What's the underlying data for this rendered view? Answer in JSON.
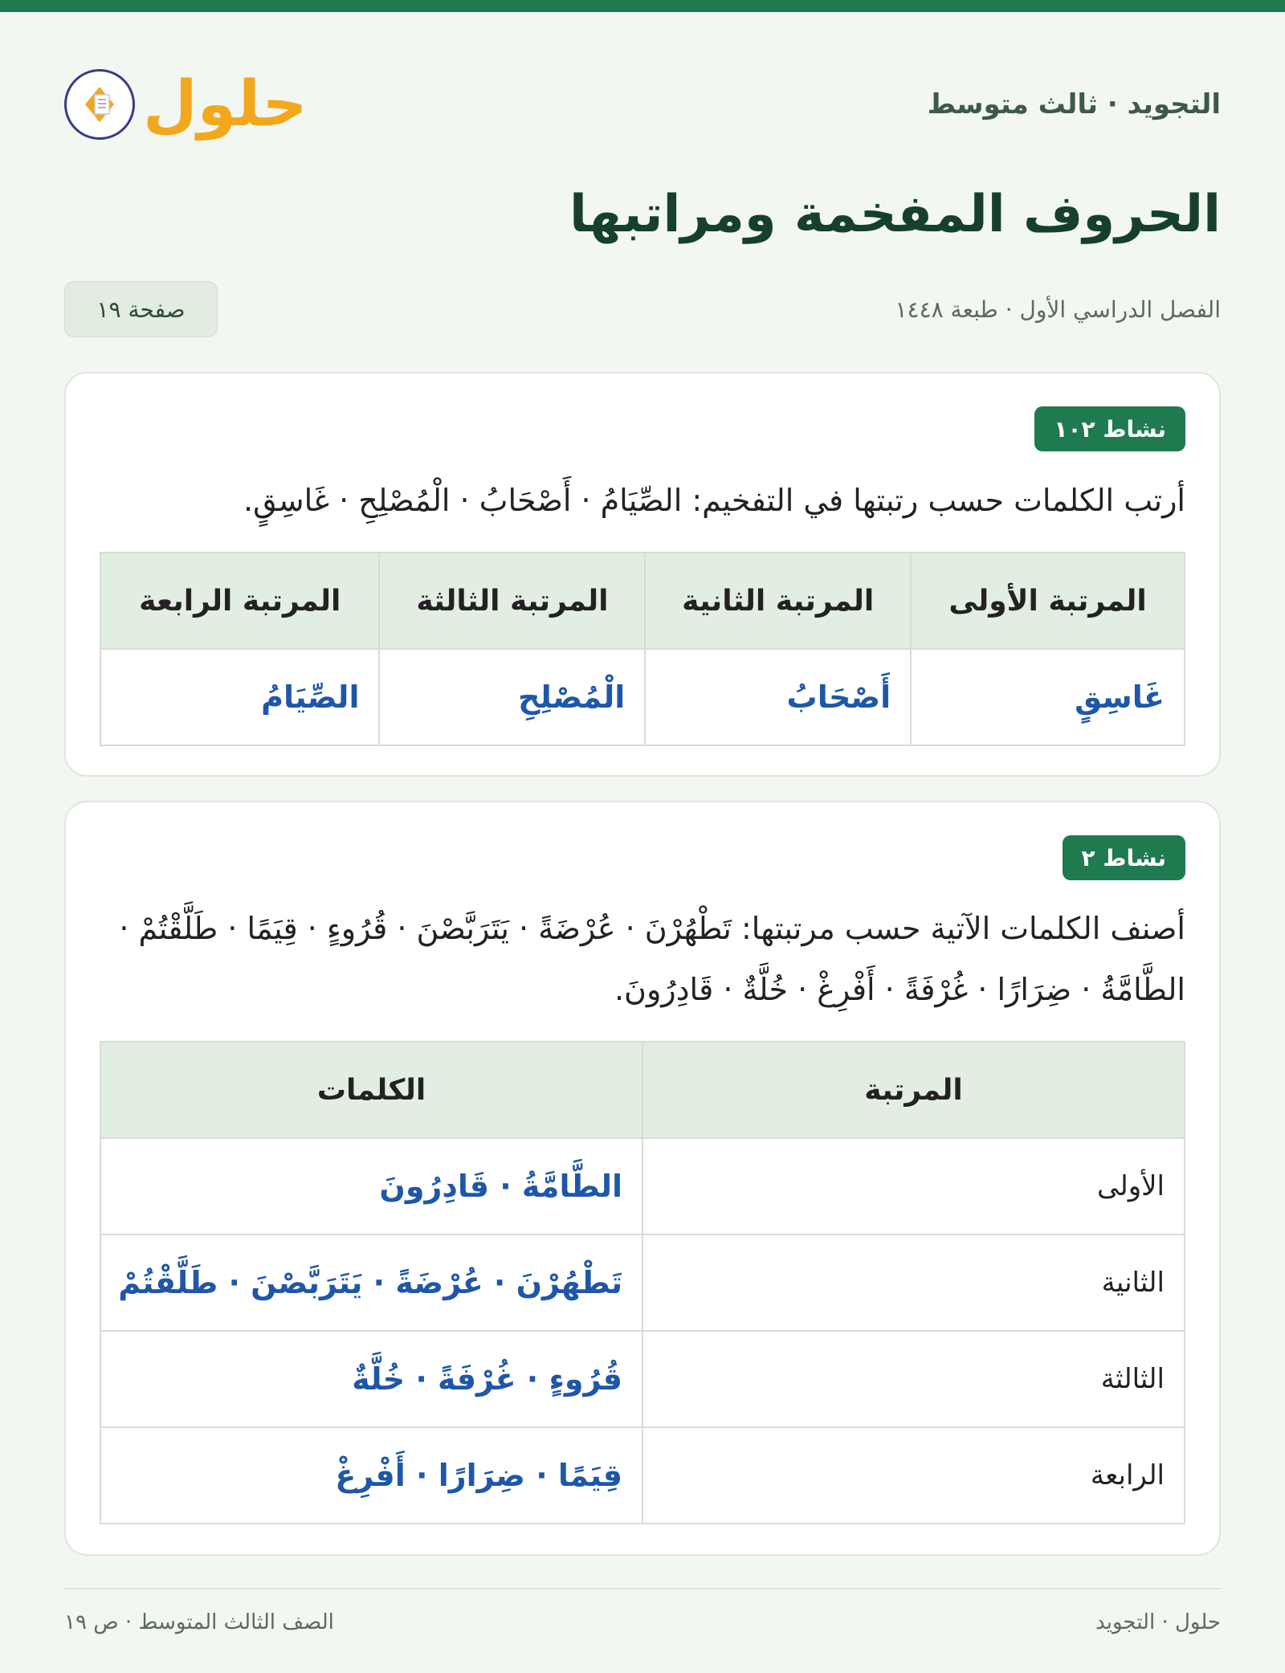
{
  "header": {
    "subject": "التجويد · ثالث متوسط",
    "logo_text": "حلول"
  },
  "title": "الحروف المفخمة ومراتبها",
  "meta": {
    "term": "الفصل الدراسي الأول · طبعة ١٤٤٨",
    "page": "صفحة ١٩"
  },
  "activity1": {
    "badge": "نشاط ١٠٢",
    "instruction": "أرتب الكلمات حسب رتبتها في التفخيم: الصِّيَامُ · أَصْحَابُ · الْمُصْلِحِ · غَاسِقٍ.",
    "headers": [
      "المرتبة الأولى",
      "المرتبة الثانية",
      "المرتبة الثالثة",
      "المرتبة الرابعة"
    ],
    "answers": [
      "غَاسِقٍ",
      "أَصْحَابُ",
      "الْمُصْلِحِ",
      "الصِّيَامُ"
    ]
  },
  "activity2": {
    "badge": "نشاط ٢",
    "instruction": "أصنف الكلمات الآتية حسب مرتبتها: تَطْهُرْنَ · عُرْضَةً · يَتَرَبَّصْنَ · قُرُوءٍ · قِيَمًا · طَلَّقْتُمْ · الطَّامَّةُ · ضِرَارًا · غُرْفَةً · أَفْرِغْ · خُلَّةٌ · قَادِرُونَ.",
    "headers": [
      "المرتبة",
      "الكلمات"
    ],
    "rows": [
      {
        "rank": "الأولى",
        "words": "الطَّامَّةُ · قَادِرُونَ"
      },
      {
        "rank": "الثانية",
        "words": "تَطْهُرْنَ · عُرْضَةً · يَتَرَبَّصْنَ · طَلَّقْتُمْ"
      },
      {
        "rank": "الثالثة",
        "words": "قُرُوءٍ · غُرْفَةً · خُلَّةٌ"
      },
      {
        "rank": "الرابعة",
        "words": "قِيَمًا · ضِرَارًا · أَفْرِغْ"
      }
    ]
  },
  "footer": {
    "right": "حلول · التجويد",
    "left": "الصف الثالث المتوسط · ص ١٩"
  },
  "colors": {
    "accent": "#1f7a4f",
    "answer": "#1f57a8",
    "logo": "#f2a81d"
  }
}
